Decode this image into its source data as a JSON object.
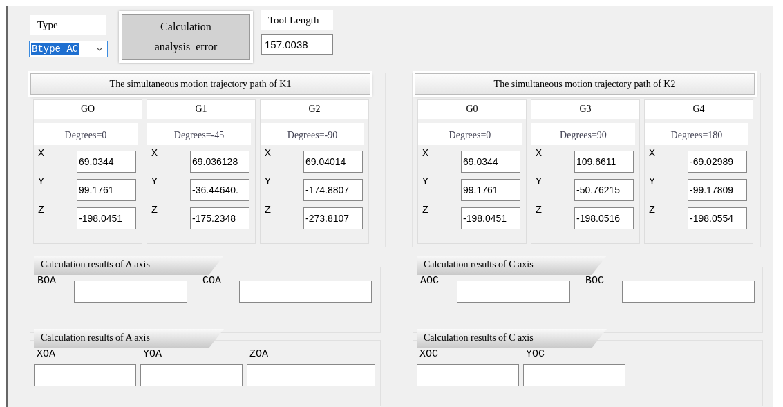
{
  "type_field": {
    "label": "Type",
    "value": "Btype_AC",
    "highlighted": true
  },
  "calculate_button": {
    "lines": [
      "Calculation",
      "analysis  error"
    ]
  },
  "tool_length": {
    "label": "Tool Length",
    "value": "157.0038"
  },
  "paths": [
    {
      "title": "The simultaneous motion trajectory path of K1",
      "groups": [
        {
          "name": "GO",
          "degrees": "Degrees=0",
          "coords": [
            {
              "axis": "X",
              "value": "69.0344"
            },
            {
              "axis": "Y",
              "value": "99.1761"
            },
            {
              "axis": "Z",
              "value": "-198.0451"
            }
          ]
        },
        {
          "name": "G1",
          "degrees": "Degrees=-45",
          "coords": [
            {
              "axis": "X",
              "value": "69.036128"
            },
            {
              "axis": "Y",
              "value": "-36.44640."
            },
            {
              "axis": "Z",
              "value": "-175.2348"
            }
          ]
        },
        {
          "name": "G2",
          "degrees": "Degrees=-90",
          "coords": [
            {
              "axis": "X",
              "value": "69.04014"
            },
            {
              "axis": "Y",
              "value": "-174.8807"
            },
            {
              "axis": "Z",
              "value": "-273.8107"
            }
          ]
        }
      ]
    },
    {
      "title": "The simultaneous motion trajectory path of K2",
      "groups": [
        {
          "name": "G0",
          "degrees": "Degrees=0",
          "coords": [
            {
              "axis": "X",
              "value": "69.0344"
            },
            {
              "axis": "Y",
              "value": "99.1761"
            },
            {
              "axis": "Z",
              "value": "-198.0451"
            }
          ]
        },
        {
          "name": "G3",
          "degrees": "Degrees=90",
          "coords": [
            {
              "axis": "X",
              "value": "109.6611"
            },
            {
              "axis": "Y",
              "value": "-50.76215"
            },
            {
              "axis": "Z",
              "value": "-198.0516"
            }
          ]
        },
        {
          "name": "G4",
          "degrees": "Degrees=180",
          "coords": [
            {
              "axis": "X",
              "value": "-69.02989"
            },
            {
              "axis": "Y",
              "value": "-99.17809"
            },
            {
              "axis": "Z",
              "value": "-198.0554"
            }
          ]
        }
      ]
    }
  ],
  "results": [
    {
      "title": "Calculation results of A axis",
      "kind": "inline",
      "fields": [
        {
          "label": "BOA"
        },
        {
          "label": "COA"
        }
      ]
    },
    {
      "title": "Calculation results of  C axis",
      "kind": "inline",
      "fields": [
        {
          "label": "AOC"
        },
        {
          "label": "BOC"
        }
      ]
    },
    {
      "title": "Calculation results of A axis",
      "kind": "stacked",
      "fields": [
        {
          "label": "XOA"
        },
        {
          "label": "YOA"
        },
        {
          "label": "ZOA"
        }
      ]
    },
    {
      "title": "Calculation results of  C axis",
      "kind": "stacked",
      "fields": [
        {
          "label": "XOC"
        },
        {
          "label": "YOC"
        }
      ]
    }
  ]
}
